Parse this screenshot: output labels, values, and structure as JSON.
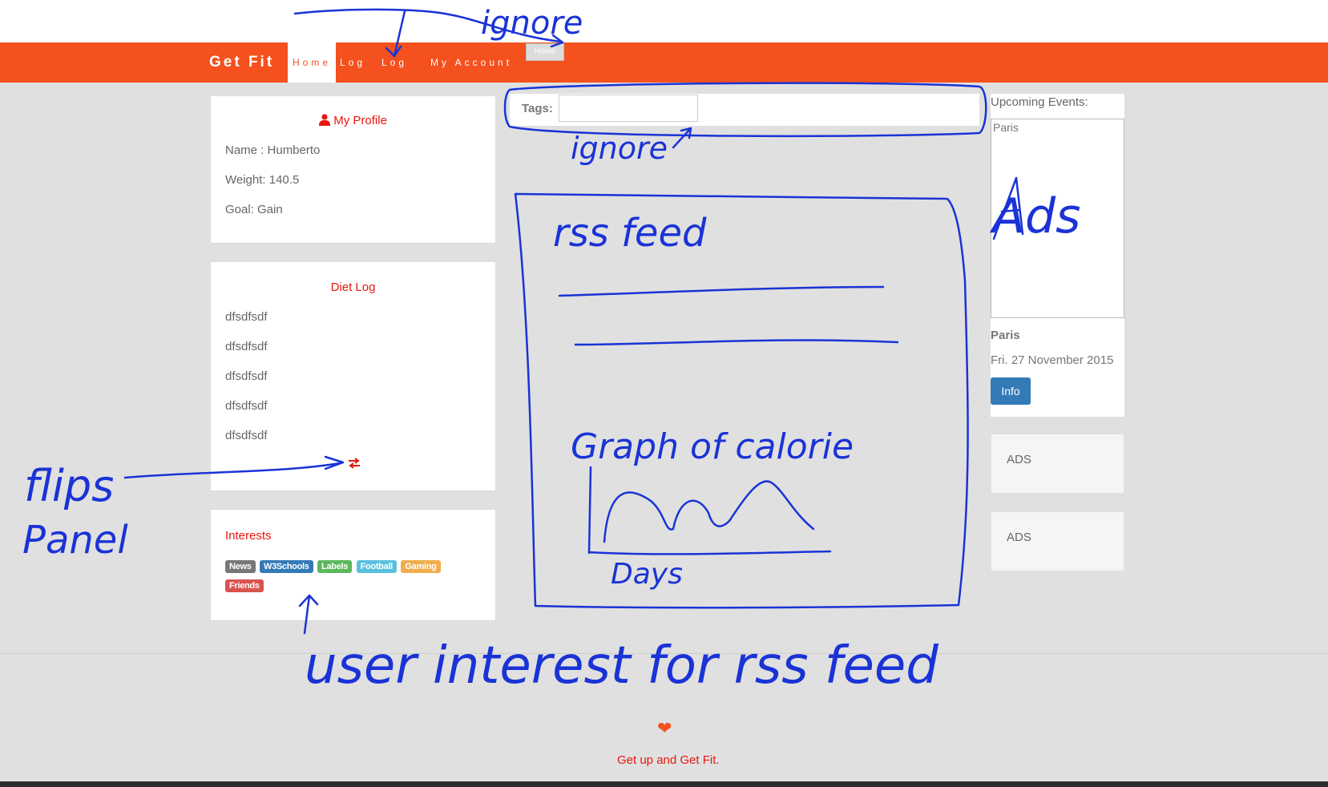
{
  "navbar": {
    "brand": "Get Fit",
    "items": [
      "Home",
      "Log",
      "Log",
      "My Account"
    ],
    "home_button": "Home"
  },
  "profile": {
    "title": "My Profile",
    "name": "Name : Humberto",
    "weight": "Weight: 140.5",
    "goal": "Goal: Gain"
  },
  "diet_log": {
    "title": "Diet Log",
    "entries": [
      "dfsdfsdf",
      "dfsdfsdf",
      "dfsdfsdf",
      "dfsdfsdf",
      "dfsdfsdf"
    ],
    "flip_icon": "swap-arrows-icon"
  },
  "interests": {
    "title": "Interests",
    "tags": [
      {
        "label": "News",
        "color": "#777777"
      },
      {
        "label": "W3Schools",
        "color": "#337ab7"
      },
      {
        "label": "Labels",
        "color": "#5cb85c"
      },
      {
        "label": "Football",
        "color": "#5bc0de"
      },
      {
        "label": "Gaming",
        "color": "#f0ad4e"
      },
      {
        "label": "Friends",
        "color": "#d9534f"
      }
    ]
  },
  "tags_bar": {
    "label": "Tags:"
  },
  "events": {
    "title": "Upcoming Events:",
    "image_alt": "Paris",
    "event_name": "Paris",
    "event_date": "Fri. 27 November 2015",
    "info_button": "Info"
  },
  "ads": [
    "ADS",
    "ADS"
  ],
  "footer": {
    "text": "Get up and Get Fit.",
    "icon": "heart-icon"
  },
  "annotations": {
    "ignore_top": "ignore",
    "ignore_mid": "ignore",
    "rss": "rss feed",
    "graph": "Graph of calorie",
    "days": "Days",
    "ads": "Ads",
    "flips": "flips",
    "panel": "Panel",
    "user_interest": "user interest for rss feed"
  },
  "colors": {
    "brand_orange": "#f4511e",
    "accent_red": "#e8170d",
    "sketch_blue": "#1a33d6",
    "info_blue": "#337ab7"
  }
}
